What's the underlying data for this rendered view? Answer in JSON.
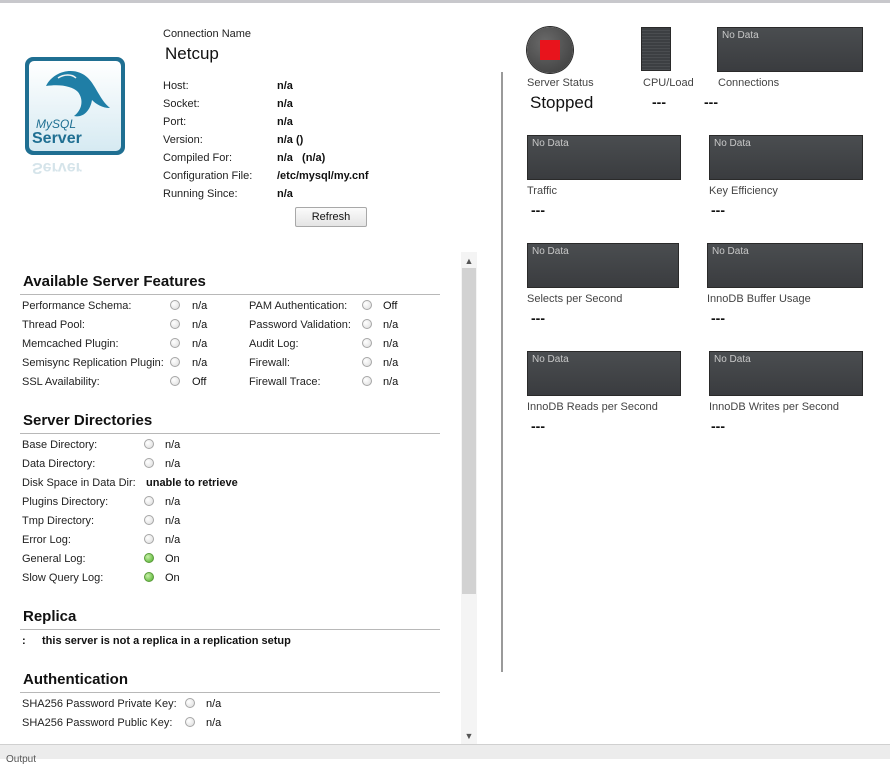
{
  "connection": {
    "caption": "Connection Name",
    "name": "Netcup",
    "fields": [
      {
        "label": "Host:",
        "value": "n/a"
      },
      {
        "label": "Socket:",
        "value": "n/a"
      },
      {
        "label": "Port:",
        "value": "n/a"
      },
      {
        "label": "Version:",
        "value": "n/a ()"
      },
      {
        "label": "Compiled For:",
        "value": "n/a   (n/a)"
      },
      {
        "label": "Configuration File:",
        "value": "/etc/mysql/my.cnf"
      },
      {
        "label": "Running Since:",
        "value": "n/a"
      }
    ],
    "refresh_label": "Refresh"
  },
  "logo": {
    "text_top": "MySQL",
    "text_bottom": "Server"
  },
  "features": {
    "title": "Available Server Features",
    "left": [
      {
        "label": "Performance Schema:",
        "value": "n/a",
        "on": false
      },
      {
        "label": "Thread Pool:",
        "value": "n/a",
        "on": false
      },
      {
        "label": "Memcached Plugin:",
        "value": "n/a",
        "on": false
      },
      {
        "label": "Semisync Replication Plugin:",
        "value": "n/a",
        "on": false
      },
      {
        "label": "SSL Availability:",
        "value": "Off",
        "on": false
      }
    ],
    "right": [
      {
        "label": "PAM Authentication:",
        "value": "Off",
        "on": false
      },
      {
        "label": "Password Validation:",
        "value": "n/a",
        "on": false
      },
      {
        "label": "Audit Log:",
        "value": "n/a",
        "on": false
      },
      {
        "label": "Firewall:",
        "value": "n/a",
        "on": false
      },
      {
        "label": "Firewall Trace:",
        "value": "n/a",
        "on": false
      }
    ]
  },
  "directories": {
    "title": "Server Directories",
    "rows": [
      {
        "label": "Base Directory:",
        "value": "n/a",
        "on": false
      },
      {
        "label": "Data Directory:",
        "value": "n/a",
        "on": false
      },
      {
        "label": "Disk Space in Data Dir:",
        "value": "unable to retrieve",
        "bold": true
      },
      {
        "label": "Plugins Directory:",
        "value": "n/a",
        "on": false
      },
      {
        "label": "Tmp Directory:",
        "value": "n/a",
        "on": false
      },
      {
        "label": "Error Log:",
        "value": "n/a",
        "on": false
      },
      {
        "label": "General Log:",
        "value": "On",
        "on": true
      },
      {
        "label": "Slow Query Log:",
        "value": "On",
        "on": true
      }
    ]
  },
  "replica": {
    "title": "Replica",
    "prefix": ":",
    "message": "this server is not a replica in a replication setup"
  },
  "authentication": {
    "title": "Authentication",
    "rows": [
      {
        "label": "SHA256 Password Private Key:",
        "value": "n/a",
        "on": false
      },
      {
        "label": "SHA256 Password Public Key:",
        "value": "n/a",
        "on": false
      }
    ]
  },
  "status": {
    "server_status_label": "Server Status",
    "server_status_value": "Stopped",
    "cpu_label": "CPU/Load",
    "cpu_value": "---",
    "connections_label": "Connections",
    "connections_value": "---",
    "connections_nodata": "No Data",
    "metrics": [
      {
        "label": "Traffic",
        "value": "---",
        "nodata": "No Data"
      },
      {
        "label": "Key Efficiency",
        "value": "---",
        "nodata": "No Data"
      },
      {
        "label": "Selects per Second",
        "value": "---",
        "nodata": "No Data"
      },
      {
        "label": "InnoDB Buffer Usage",
        "value": "---",
        "nodata": "No Data"
      },
      {
        "label": "InnoDB Reads per Second",
        "value": "---",
        "nodata": "No Data"
      },
      {
        "label": "InnoDB Writes per Second",
        "value": "---",
        "nodata": "No Data"
      }
    ],
    "stop_color": "#e8141c"
  },
  "statusbar": {
    "text": "Output"
  }
}
